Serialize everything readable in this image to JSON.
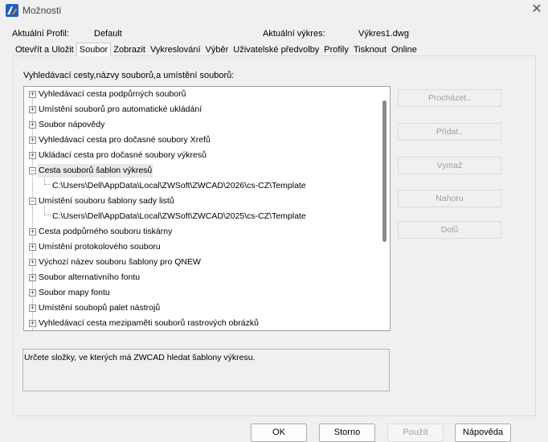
{
  "window": {
    "title": "Možnosti",
    "close_glyph": "✕"
  },
  "profile": {
    "current_profile_label": "Aktuální Profil:",
    "current_profile_value": "Default",
    "current_drawing_label": "Aktuální výkres:",
    "current_drawing_value": "Výkres1.dwg"
  },
  "tabs": [
    {
      "label": "Otevřít a Uložit",
      "active": false
    },
    {
      "label": "Soubor",
      "active": true
    },
    {
      "label": "Zobrazit",
      "active": false
    },
    {
      "label": "Vykreslování",
      "active": false
    },
    {
      "label": "Výběr",
      "active": false
    },
    {
      "label": "Uživatelské předvolby",
      "active": false
    },
    {
      "label": "Profily",
      "active": false
    },
    {
      "label": "Tisknout",
      "active": false
    },
    {
      "label": "Online",
      "active": false
    }
  ],
  "file_tab": {
    "section_label": "Vyhledávací cesty,názvy souborů,a umístění souborů:",
    "tree": [
      {
        "label": "Vyhledávací cesta podpůrných souborů",
        "expander": "+"
      },
      {
        "label": "Umístění souborů pro automatické ukládání",
        "expander": "+"
      },
      {
        "label": "Soubor nápovědy",
        "expander": "+"
      },
      {
        "label": "Vyhledávací cesta pro dočasné soubory Xrefů",
        "expander": "+"
      },
      {
        "label": "Ukládací cesta pro dočasné soubory výkresů",
        "expander": "+"
      },
      {
        "label": "Cesta souborů šablon výkresů",
        "expander": "−"
      },
      {
        "label": "C:\\Users\\Dell\\AppData\\Local\\ZWSoft\\ZWCAD\\2026\\cs-CZ\\Template",
        "expander": ""
      },
      {
        "label": "Umístění souboru šablony sady listů",
        "expander": "−"
      },
      {
        "label": "C:\\Users\\Dell\\AppData\\Local\\ZWSoft\\ZWCAD\\2025\\cs-CZ\\Template",
        "expander": ""
      },
      {
        "label": "Cesta podpůrného souboru tiskárny",
        "expander": "+"
      },
      {
        "label": "Umístění protokolového souboru",
        "expander": "+"
      },
      {
        "label": "Výchozí název souboru šablony pro QNEW",
        "expander": "+"
      },
      {
        "label": "Soubor alternativního fontu",
        "expander": "+"
      },
      {
        "label": "Soubor mapy fontu",
        "expander": "+"
      },
      {
        "label": "Umístění soubopů palet nástrojů",
        "expander": "+"
      },
      {
        "label": "Vyhledávací cesta mezipaměti souborů rastrových obrázků",
        "expander": "+"
      }
    ],
    "buttons": {
      "browse": "Procházet..",
      "add": "Přidat..",
      "remove": "Vymaž",
      "up": "Nahoru",
      "down": "Dolů"
    },
    "description": "Určete složky, ve kterých má ZWCAD hledat šablony výkresu."
  },
  "dialog_buttons": {
    "ok": "OK",
    "cancel": "Storno",
    "apply": "Použít",
    "help": "Nápověda"
  },
  "colors": {
    "window_bg": "#f0f0f0",
    "app_icon_blue": "#1f5fbf",
    "app_icon_orange": "#f28c1e"
  }
}
